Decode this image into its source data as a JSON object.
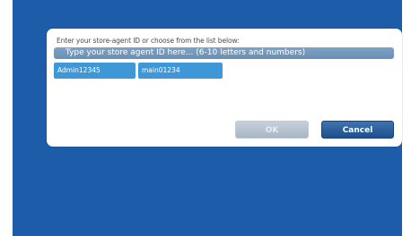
{
  "colors": {
    "background": "#1c5ca8",
    "dialog": "#ffffff",
    "input_bg": "#7297bc",
    "agent_chip": "#3f97d8",
    "ok_disabled": "#b8c4cf",
    "cancel_bg": "#2a5f9c"
  },
  "dialog": {
    "prompt": "Enter your store-agent ID or choose from the list below:",
    "input": {
      "value": "",
      "placeholder": "Type your store agent ID here... (6-10 letters and numbers)"
    },
    "agents": [
      {
        "label": "Admin12345"
      },
      {
        "label": "main01234"
      }
    ],
    "buttons": {
      "ok": "OK",
      "ok_enabled": false,
      "cancel": "Cancel"
    }
  }
}
